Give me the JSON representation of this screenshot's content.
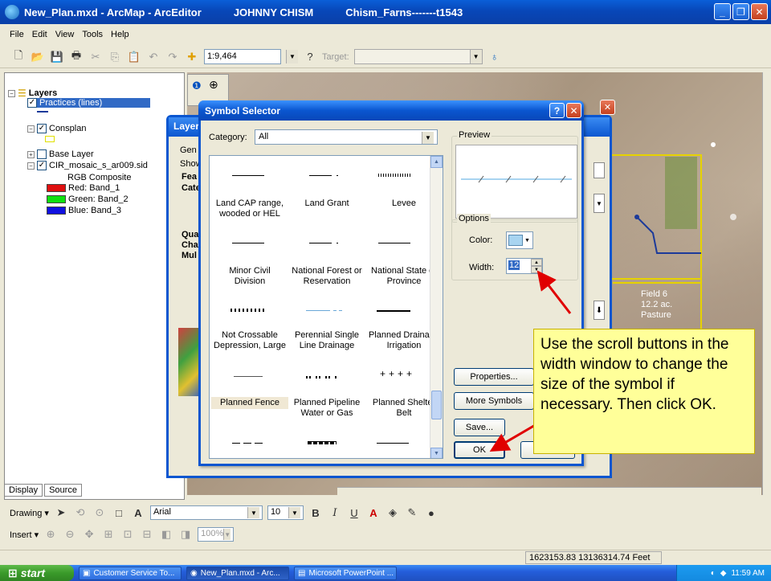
{
  "titlebar": {
    "app_title": "New_Plan.mxd - ArcMap - ArcEditor",
    "user": "JOHNNY CHISM",
    "plan": "Chism_Farns-------t1543"
  },
  "menu": [
    "File",
    "Edit",
    "View",
    "Tools",
    "Help"
  ],
  "toolbar": {
    "scale": "1:9,464",
    "target_label": "Target:"
  },
  "toc": {
    "root": "Layers",
    "layers": [
      {
        "name": "Practices (lines)"
      },
      {
        "name": "Consplan"
      },
      {
        "name": "Base Layer"
      },
      {
        "name": "CIR_mosaic_s_ar009.sid"
      }
    ],
    "rgb_title": "RGB Composite",
    "bands": [
      {
        "label": "Red:   Band_1",
        "color": "#e01010"
      },
      {
        "label": "Green: Band_2",
        "color": "#10e010"
      },
      {
        "label": "Blue:  Band_3",
        "color": "#1010e0"
      }
    ],
    "tabs": [
      "Display",
      "Source"
    ]
  },
  "layer_props": {
    "title": "Layer",
    "tab_fragment": "Gen",
    "show": "Show",
    "fea": "Fea",
    "cat": "Cate",
    "qua": "Qua",
    "cha": "Cha",
    "mul": "Mul"
  },
  "map_labels": {
    "field": "Field 6",
    "acres": "12.2 ac.",
    "use": "Pasture"
  },
  "dialog": {
    "title": "Symbol Selector",
    "category_label": "Category:",
    "category_value": "All",
    "preview_label": "Preview",
    "options_label": "Options",
    "color_label": "Color:",
    "width_label": "Width:",
    "width_value": "12",
    "buttons": {
      "properties": "Properties...",
      "more_symbols": "More Symbols",
      "save": "Save...",
      "ok": "OK",
      "cancel": "Cancel"
    },
    "symbols": [
      {
        "name": "Land CAP range, wooded or HEL"
      },
      {
        "name": "Land Grant"
      },
      {
        "name": "Levee"
      },
      {
        "name": "Minor Civil Division"
      },
      {
        "name": "National Forest or Reservation"
      },
      {
        "name": "National State or Province"
      },
      {
        "name": "Not Crossable Depression, Large"
      },
      {
        "name": "Perennial Single Line Drainage"
      },
      {
        "name": "Planned Drainage Irrigation"
      },
      {
        "name": "Planned Fence"
      },
      {
        "name": "Planned Pipeline Water or Gas"
      },
      {
        "name": "Planned Shelter Belt"
      }
    ]
  },
  "callout": "Use the scroll buttons in the width window to change the size of the symbol if necessary. Then click OK.",
  "drawing_toolbar": {
    "drawing": "Drawing",
    "font": "Arial",
    "size": "10"
  },
  "insert_toolbar": {
    "insert": "Insert",
    "zoom": "100%"
  },
  "status": {
    "coords": "1623153.83  13136314.74 Feet"
  },
  "taskbar": {
    "start": "start",
    "tasks": [
      "Customer Service To...",
      "New_Plan.mxd - Arc...",
      "Microsoft PowerPoint ..."
    ],
    "clock": "11:59 AM"
  }
}
